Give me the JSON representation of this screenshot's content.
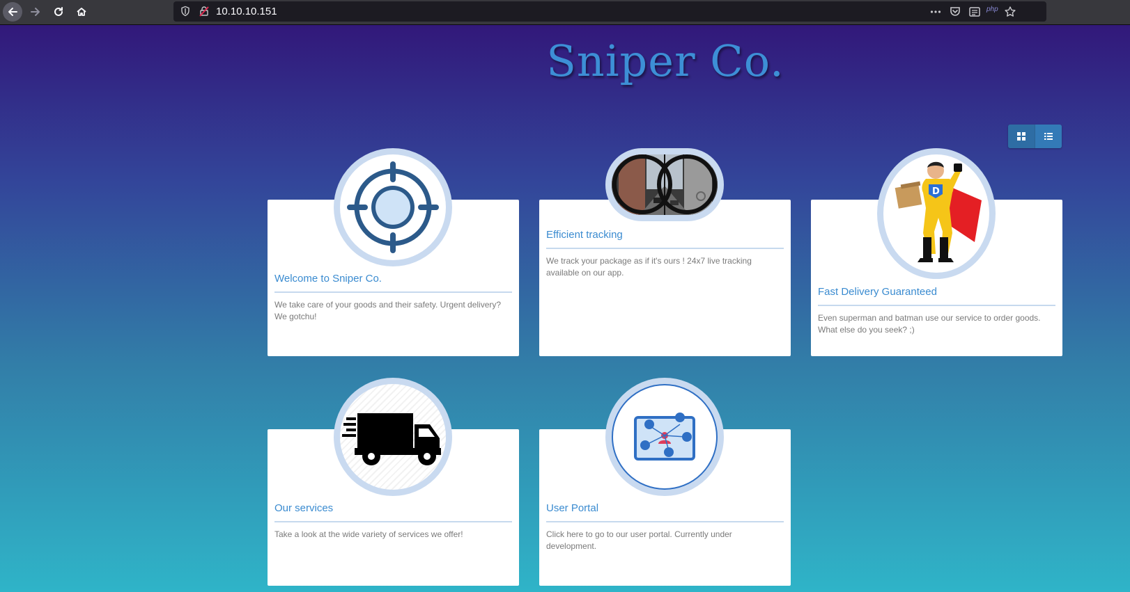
{
  "browser": {
    "url": "10.10.10.151",
    "php_badge": "php"
  },
  "site": {
    "title": "Sniper Co."
  },
  "view_toggle": {
    "grid_icon": "grid-icon",
    "list_icon": "list-icon"
  },
  "cards": [
    {
      "title": "Welcome to Sniper Co.",
      "text": "We take care of your goods and their safety. Urgent delivery? We gotchu!",
      "image": "crosshair-icon"
    },
    {
      "title": "Efficient tracking",
      "text": "We track your package as if it's ours ! 24x7 live tracking available on our app.",
      "image": "scope-photo"
    },
    {
      "title": "Fast Delivery Guaranteed",
      "text": "Even superman and batman use our service to order goods. What else do you seek? ;)",
      "image": "superhero-illustration"
    },
    {
      "title": "Our services",
      "text": "Take a look at the wide variety of services we offer!",
      "image": "truck-icon"
    },
    {
      "title": "User Portal",
      "text": "Click here to go to our user portal. Currently under development.",
      "image": "portal-network-icon"
    }
  ],
  "colors": {
    "accent": "#3a8bd0",
    "toggle": "#337ab7",
    "medal_ring": "#c9daf0"
  }
}
